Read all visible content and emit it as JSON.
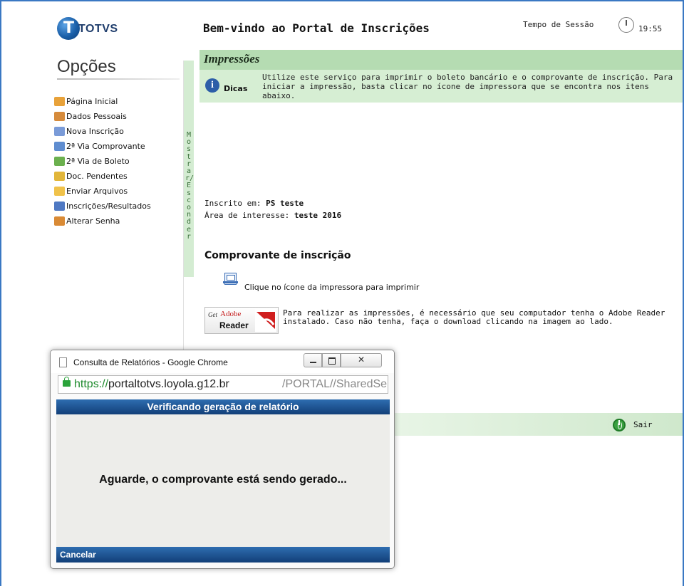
{
  "header": {
    "logo_text": "TOTVS",
    "logo_letter": "T",
    "welcome": "Bem-vindo ao Portal de Inscrições",
    "session_label": "Tempo de Sessão",
    "session_time": "19:55"
  },
  "sidebar": {
    "title": "Opções",
    "toggle_label": "Mostrar/Esconder",
    "items": [
      {
        "label": "Página Inicial",
        "icon": "home-icon",
        "color": "#e8a23a"
      },
      {
        "label": "Dados Pessoais",
        "icon": "person-icon",
        "color": "#d68b3c"
      },
      {
        "label": "Nova Inscrição",
        "icon": "form-icon",
        "color": "#7a9bd8"
      },
      {
        "label": "2ª Via Comprovante",
        "icon": "printer-icon",
        "color": "#5f8dd0"
      },
      {
        "label": "2ª Via de Boleto",
        "icon": "barcode-icon",
        "color": "#6bb04e"
      },
      {
        "label": "Doc. Pendentes",
        "icon": "warning-document-icon",
        "color": "#e2b63a"
      },
      {
        "label": "Enviar Arquivos",
        "icon": "upload-icon",
        "color": "#f0c24a"
      },
      {
        "label": "Inscrições/Resultados",
        "icon": "list-download-icon",
        "color": "#4f79c3"
      },
      {
        "label": "Alterar Senha",
        "icon": "user-key-icon",
        "color": "#d98a35"
      }
    ]
  },
  "main": {
    "section_title": "Impressões",
    "tip_label": "Dicas",
    "tip_icon": "info-icon",
    "tip_text": "Utilize este serviço para imprimir o boleto bancário e o comprovante de inscrição. Para iniciar a impressão, basta clicar no ícone de impressora que se encontra nos itens abaixo.",
    "inscrito_label": "Inscrito em:",
    "inscrito_value": "PS teste",
    "area_label": "Área de interesse:",
    "area_value": "teste 2016",
    "comprovante_title": "Comprovante de inscrição",
    "print_hint": "Clique no ícone da impressora para imprimir",
    "adobe_get": "Get",
    "adobe_brand": "Adobe",
    "adobe_reader": "Reader",
    "adobe_text": "Para realizar as impressões, é necessário que seu computador tenha o Adobe Reader instalado. Caso não tenha, faça o download clicando na imagem ao lado.",
    "logout_label": "Sair"
  },
  "popup": {
    "window_title": "Consulta de Relatórios - Google Chrome",
    "url_scheme": "https://",
    "url_host": "portaltotvs.loyola.g12.br",
    "url_path": "/PORTAL//SharedSer",
    "header": "Verificando geração de relatório",
    "message": "Aguarde, o comprovante está sendo gerado...",
    "cancel_label": "Cancelar"
  },
  "colors": {
    "frame": "#3a78c3",
    "title_green": "#b5dcb2",
    "tip_green": "#d6eed3",
    "popup_blue": "#1f5a9c"
  }
}
